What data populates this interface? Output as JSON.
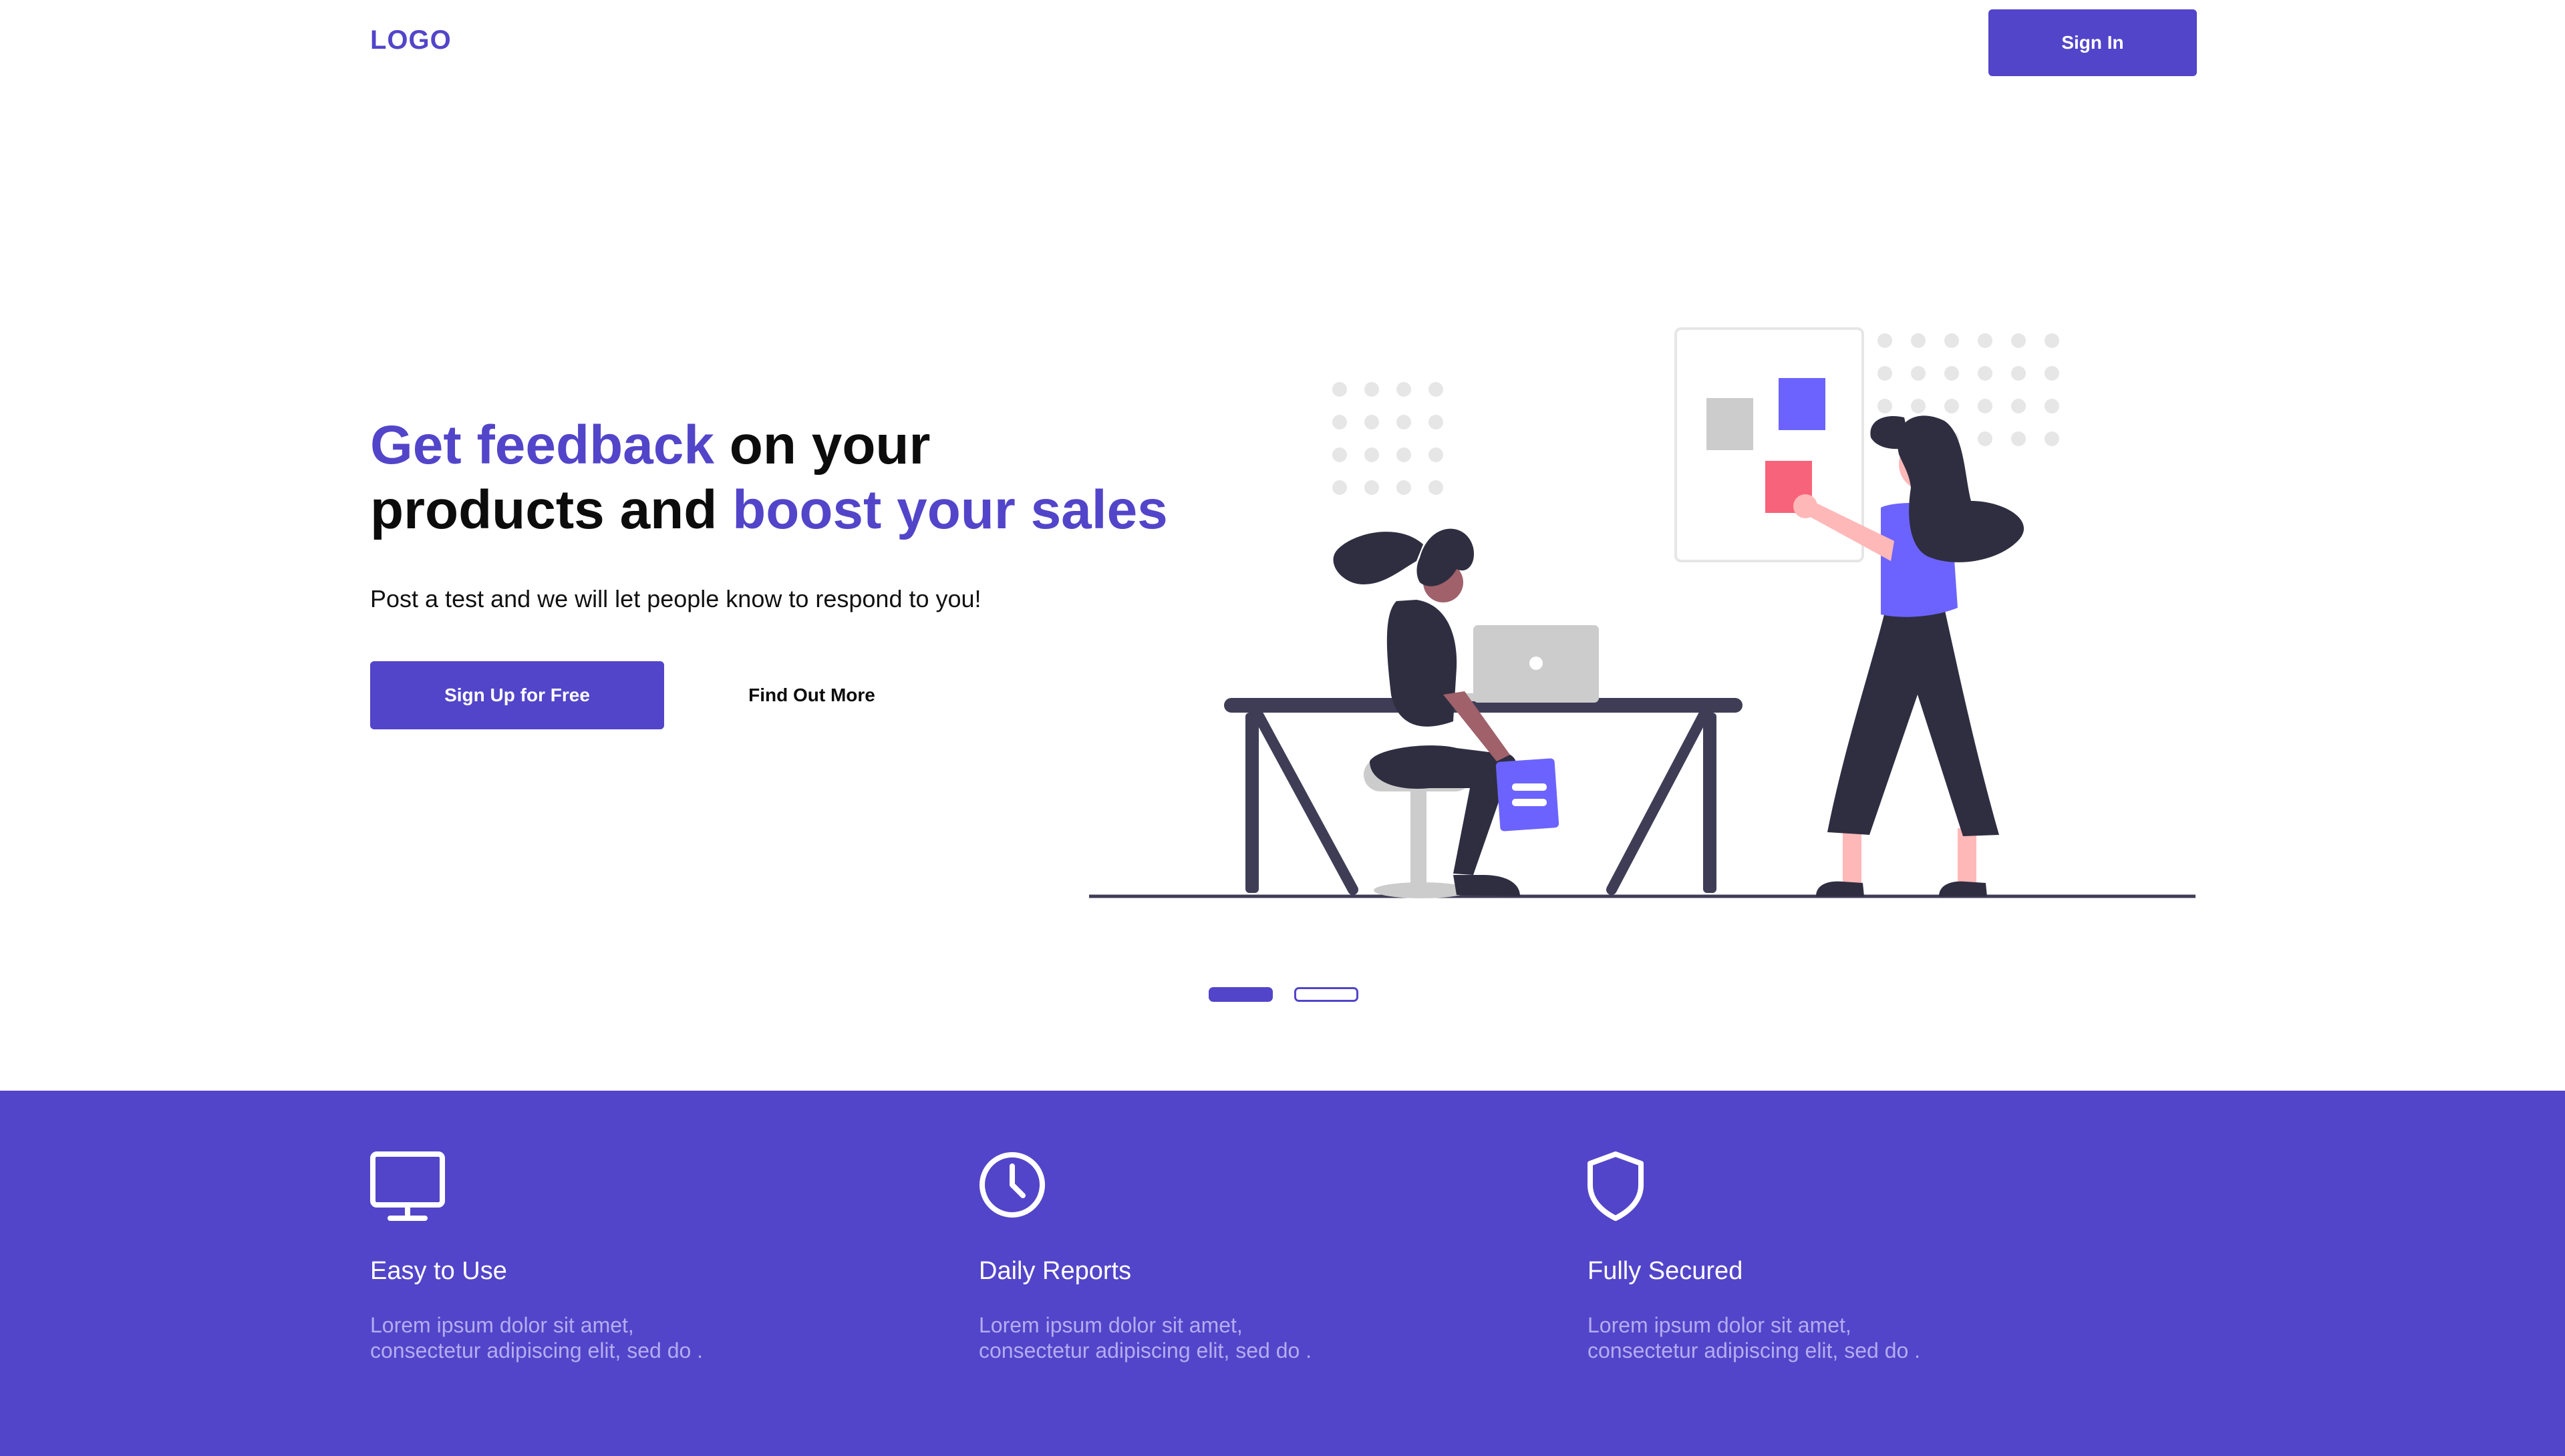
{
  "header": {
    "logo": "LOGO",
    "signin_label": "Sign In"
  },
  "hero": {
    "headline_part1": "Get feedback",
    "headline_part2": " on your",
    "headline_part3": "products and ",
    "headline_part4": "boost your sales",
    "subtitle": "Post a test and we will let people know to respond to you!",
    "cta_primary": "Sign Up for Free",
    "cta_secondary": "Find Out More"
  },
  "carousel": {
    "slide_count": 2,
    "active_index": 0
  },
  "features": [
    {
      "icon": "monitor-icon",
      "title": "Easy to Use",
      "text_line1": "Lorem ipsum dolor sit amet,",
      "text_line2": "consectetur adipiscing elit, sed do ."
    },
    {
      "icon": "clock-icon",
      "title": "Daily Reports",
      "text_line1": "Lorem ipsum dolor sit amet,",
      "text_line2": "consectetur adipiscing elit, sed do ."
    },
    {
      "icon": "shield-icon",
      "title": "Fully Secured",
      "text_line1": "Lorem ipsum dolor sit amet,",
      "text_line2": "consectetur adipiscing elit, sed do ."
    }
  ],
  "colors": {
    "brand": "#5245c9",
    "accent_square": "#6c63ff",
    "pink_square": "#f7637a",
    "dark": "#2f2e41",
    "skin_light": "#ffb8b8",
    "skin_dark": "#a0616a",
    "grey": "#cccccc"
  }
}
